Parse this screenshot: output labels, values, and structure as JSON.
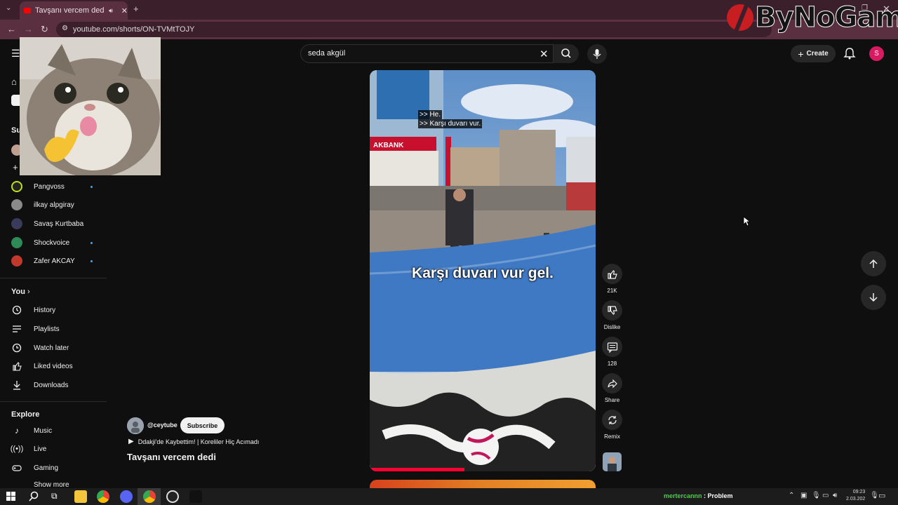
{
  "browser": {
    "tab_title": "Tavşanı vercem dedi - YouTube",
    "url": "youtube.com/shorts/ON-TVMtTOJY"
  },
  "watermark": {
    "text": "ByNoGame"
  },
  "header": {
    "search_value": "seda akgül",
    "create_label": "Create",
    "avatar_letter": "S"
  },
  "sidebar": {
    "subscriptions": [
      {
        "name": "Pangvoss",
        "color": "#2a2a2a",
        "new": true
      },
      {
        "name": "ilkay alpgiray",
        "color": "#8a8a8a",
        "new": false
      },
      {
        "name": "Savaş Kurtbaba",
        "color": "#3a3a5a",
        "new": false
      },
      {
        "name": "Shockvoice",
        "color": "#2e8b57",
        "new": true
      },
      {
        "name": "Zafer AKCAY",
        "color": "#c0392b",
        "new": true
      }
    ],
    "you_heading": "You",
    "you_items": [
      {
        "label": "History",
        "icon": "history-icon"
      },
      {
        "label": "Playlists",
        "icon": "playlists-icon"
      },
      {
        "label": "Watch later",
        "icon": "clock-icon"
      },
      {
        "label": "Liked videos",
        "icon": "thumb-up-icon"
      },
      {
        "label": "Downloads",
        "icon": "download-icon"
      }
    ],
    "explore_heading": "Explore",
    "explore_items": [
      {
        "label": "Music",
        "icon": "music-icon"
      },
      {
        "label": "Live",
        "icon": "live-icon"
      },
      {
        "label": "Gaming",
        "icon": "gaming-icon"
      }
    ],
    "show_more": "Show more"
  },
  "video": {
    "caption_lines": [
      ">> He.",
      ">> Karşı duvarı vur."
    ],
    "subtitle": "Karşı duvarı vur gel.",
    "sign_text": "AKBANK"
  },
  "actions": {
    "likes": "21K",
    "dislike": "Dislike",
    "comments": "128",
    "share": "Share",
    "remix": "Remix"
  },
  "channel": {
    "handle": "@ceytube",
    "subscribe": "Subscribe",
    "now_playing": "Ddakji'de Kaybettim! | Koreliler Hiç Acımadı",
    "title": "Tavşanı vercem dedi"
  },
  "taskbar": {
    "user": "mertercannn",
    "message": ": Problem",
    "time": "09:23",
    "date": "2.03.202"
  }
}
